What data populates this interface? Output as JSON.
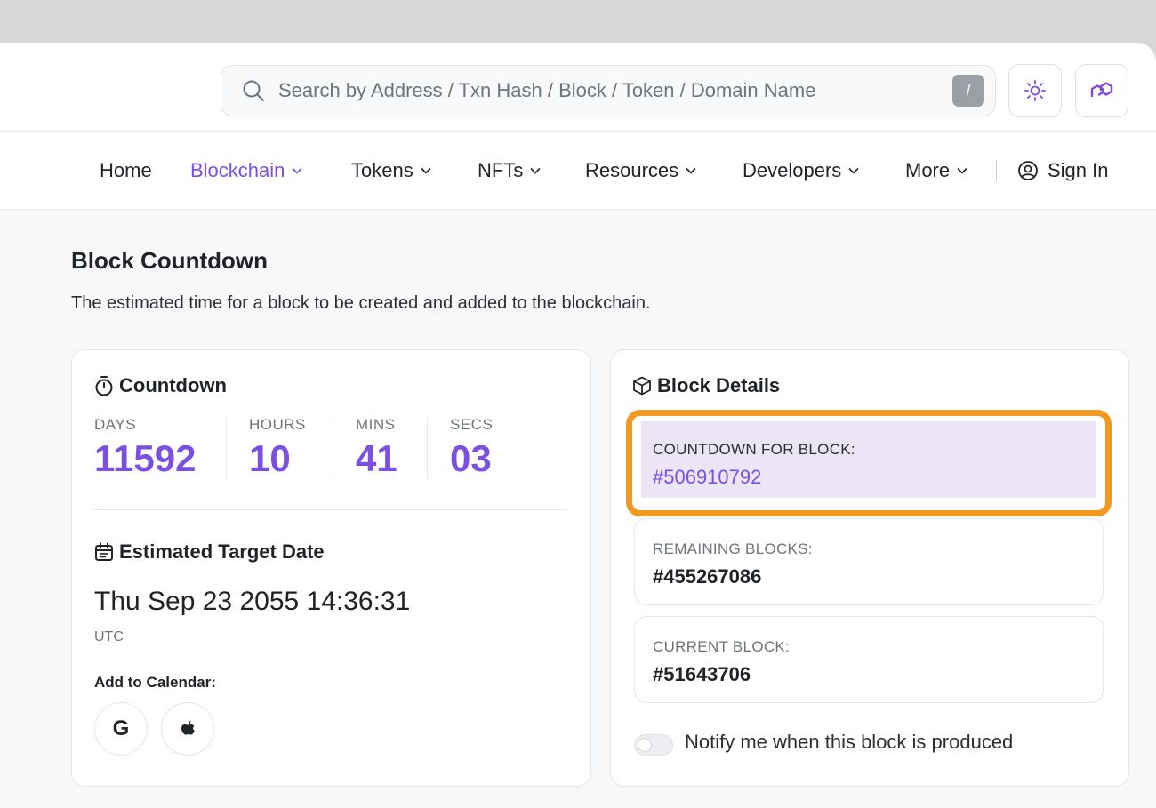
{
  "header": {
    "search_placeholder": "Search by Address / Txn Hash / Block / Token / Domain Name",
    "search_shortcut": "/",
    "theme_icon": "sun-icon",
    "network_icon": "polygon-logo-icon"
  },
  "nav": {
    "items": [
      {
        "label": "Home",
        "dropdown": false
      },
      {
        "label": "Blockchain",
        "dropdown": true,
        "active": true
      },
      {
        "label": "Tokens",
        "dropdown": true
      },
      {
        "label": "NFTs",
        "dropdown": true
      },
      {
        "label": "Resources",
        "dropdown": true
      },
      {
        "label": "Developers",
        "dropdown": true
      },
      {
        "label": "More",
        "dropdown": true
      }
    ],
    "sign_in": "Sign In"
  },
  "page": {
    "title": "Block Countdown",
    "description": "The estimated time for a block to be created and added to the blockchain."
  },
  "countdown": {
    "title": "Countdown",
    "units": [
      {
        "label": "DAYS",
        "value": "11592"
      },
      {
        "label": "HOURS",
        "value": "10"
      },
      {
        "label": "MINS",
        "value": "41"
      },
      {
        "label": "SECS",
        "value": "03"
      }
    ],
    "target_title": "Estimated Target Date",
    "target_date": "Thu Sep 23 2055 14:36:31",
    "timezone": "UTC",
    "add_to_calendar": "Add to Calendar:",
    "calendar_google": "G"
  },
  "block_details": {
    "title": "Block Details",
    "countdown_for_label": "COUNTDOWN FOR BLOCK:",
    "countdown_for_value": "#506910792",
    "remaining_label": "REMAINING BLOCKS:",
    "remaining_value": "#455267086",
    "current_label": "CURRENT BLOCK:",
    "current_value": "#51643706",
    "notify_label": "Notify me when this block is produced"
  },
  "colors": {
    "accent": "#7b4fe0",
    "highlight": "#f29a1f"
  }
}
